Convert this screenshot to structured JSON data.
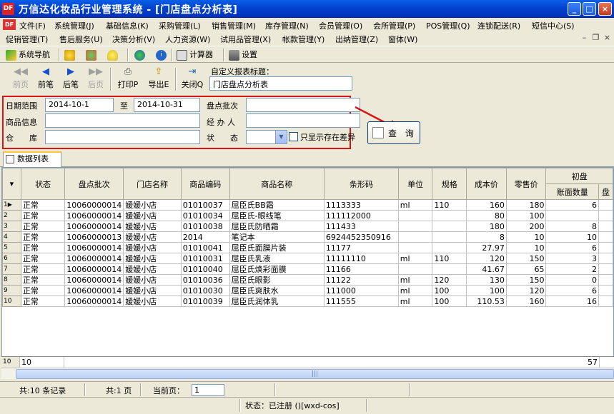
{
  "window": {
    "title": "万信达化妆品行业管理系统 - [门店盘点分析表]",
    "app_icon": "DF"
  },
  "menu": {
    "row1": [
      "文件(F)",
      "系统管理(J)",
      "基础信息(K)",
      "采购管理(L)",
      "销售管理(M)",
      "库存管理(N)",
      "会员管理(O)",
      "会所管理(P)",
      "POS管理(Q)",
      "连锁配送(R)",
      "短信中心(S)"
    ],
    "row2": [
      "促销管理(T)",
      "售后服务(U)",
      "决策分析(V)",
      "人力资源(W)",
      "试用品管理(X)",
      "帐款管理(Y)",
      "出纳管理(Z)",
      "窗体(W)"
    ]
  },
  "toolbar": {
    "nav_label": "系统导航",
    "calc_label": "计算器",
    "settings_label": "设置"
  },
  "nav_buttons": {
    "first": "前页",
    "prev": "前笔",
    "next": "后笔",
    "last": "后页",
    "print": "打印P",
    "export": "导出E",
    "close": "关闭Q"
  },
  "report_title": {
    "label": "自定义报表标题：",
    "value": "门店盘点分析表"
  },
  "filters": {
    "date_label": "日期范围",
    "date_from": "2014-10-1",
    "date_to_label": "至",
    "date_to": "2014-10-31",
    "batch_label": "盘点批次",
    "batch_value": "",
    "product_label": "商品信息",
    "product_value": "",
    "operator_label": "经 办 人",
    "operator_value": "",
    "warehouse_label": "仓　　库",
    "warehouse_value": "",
    "status_label": "状　　态",
    "status_value": "",
    "diff_only_label": "只显示存在差异"
  },
  "query_button": "查 询",
  "tab": {
    "label": "数据列表"
  },
  "table": {
    "group_header": "初盘",
    "columns": [
      "状态",
      "盘点批次",
      "门店名称",
      "商品编码",
      "商品名称",
      "条形码",
      "单位",
      "规格",
      "成本价",
      "零售价"
    ],
    "sub_columns": [
      "账面数量",
      "盘"
    ],
    "rows": [
      {
        "n": "1",
        "status": "正常",
        "batch": "10060000014",
        "store": "媛媛小店",
        "code": "01010037",
        "name": "屈臣氏BB霜",
        "barcode": "1113333",
        "unit": "ml",
        "spec": "110",
        "cost": "160",
        "retail": "180",
        "book_qty": "6"
      },
      {
        "n": "2",
        "status": "正常",
        "batch": "10060000014",
        "store": "媛媛小店",
        "code": "01010034",
        "name": "屈臣氏-眼线笔",
        "barcode": "111112000",
        "unit": "",
        "spec": "",
        "cost": "80",
        "retail": "100",
        "book_qty": ""
      },
      {
        "n": "3",
        "status": "正常",
        "batch": "10060000014",
        "store": "媛媛小店",
        "code": "01010038",
        "name": "屈臣氏防晒霜",
        "barcode": "111433",
        "unit": "",
        "spec": "",
        "cost": "180",
        "retail": "200",
        "book_qty": "8"
      },
      {
        "n": "4",
        "status": "正常",
        "batch": "10060000013",
        "store": "媛媛小店",
        "code": "2014",
        "name": "笔记本",
        "barcode": "6924452350916",
        "unit": "",
        "spec": "",
        "cost": "8",
        "retail": "10",
        "book_qty": "10"
      },
      {
        "n": "5",
        "status": "正常",
        "batch": "10060000014",
        "store": "媛媛小店",
        "code": "01010041",
        "name": "屈臣氏面膜片装",
        "barcode": "11177",
        "unit": "",
        "spec": "",
        "cost": "27.97",
        "retail": "10",
        "book_qty": "6"
      },
      {
        "n": "6",
        "status": "正常",
        "batch": "10060000014",
        "store": "媛媛小店",
        "code": "01010031",
        "name": "屈臣氏乳液",
        "barcode": "11111110",
        "unit": "ml",
        "spec": "110",
        "cost": "120",
        "retail": "150",
        "book_qty": "3"
      },
      {
        "n": "7",
        "status": "正常",
        "batch": "10060000014",
        "store": "媛媛小店",
        "code": "01010040",
        "name": "屈臣氏焕彩面膜",
        "barcode": "11166",
        "unit": "",
        "spec": "",
        "cost": "41.67",
        "retail": "65",
        "book_qty": "2"
      },
      {
        "n": "8",
        "status": "正常",
        "batch": "10060000014",
        "store": "媛媛小店",
        "code": "01010036",
        "name": "屈臣氏眼影",
        "barcode": "11122",
        "unit": "ml",
        "spec": "120",
        "cost": "130",
        "retail": "150",
        "book_qty": "0"
      },
      {
        "n": "9",
        "status": "正常",
        "batch": "10060000014",
        "store": "媛媛小店",
        "code": "01010030",
        "name": "屈臣氏爽肤水",
        "barcode": "111000",
        "unit": "ml",
        "spec": "100",
        "cost": "100",
        "retail": "120",
        "book_qty": "6"
      },
      {
        "n": "10",
        "status": "正常",
        "batch": "10060000014",
        "store": "媛媛小店",
        "code": "01010039",
        "name": "屈臣氏润体乳",
        "barcode": "111555",
        "unit": "ml",
        "spec": "100",
        "cost": "110.53",
        "retail": "160",
        "book_qty": "16"
      }
    ],
    "footer": {
      "row_num": "10",
      "count": "10",
      "book_qty_total": "57"
    }
  },
  "pager": {
    "records": "共:10 条记录",
    "pages": "共:1 页",
    "current_label": "当前页：",
    "current": "1"
  },
  "status": {
    "text": "状态：已注册 ()[wxd-cos]"
  },
  "colors": {
    "title_bar": "#0346d0",
    "highlight_box": "#d41818",
    "window_bg": "#ece9d8"
  }
}
